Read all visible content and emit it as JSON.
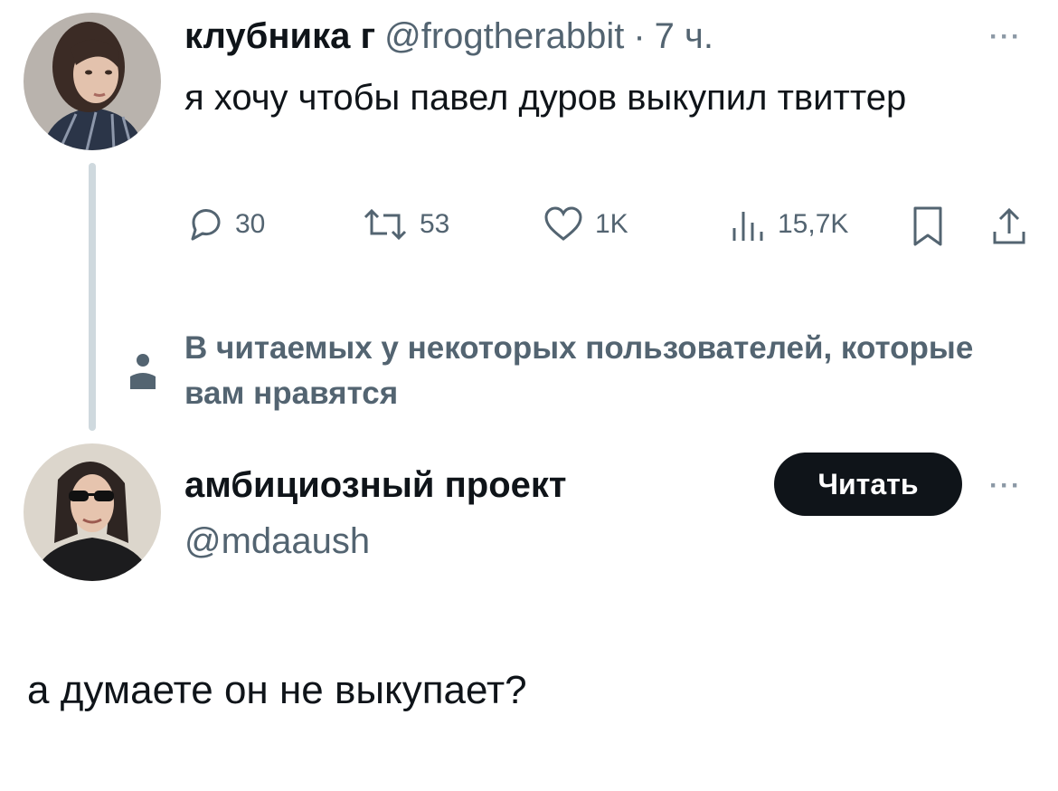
{
  "tweet": {
    "author_name": "клубника г",
    "author_handle": "@frogtherabbit",
    "separator": "·",
    "time": "7 ч.",
    "more": "···",
    "text": "я хочу чтобы павел дуров выкупил твиттер",
    "actions": {
      "replies": "30",
      "retweets": "53",
      "likes": "1K",
      "views": "15,7K"
    }
  },
  "social_context": {
    "text": "В читаемых у некоторых пользователей, которые вам нравятся"
  },
  "suggested_user": {
    "name": "амбициозный проект",
    "handle": "@mdaaush",
    "follow_label": "Читать",
    "more": "···"
  },
  "reply": {
    "text": "а думаете он не выкупает?"
  },
  "colors": {
    "text": "#0f1419",
    "secondary": "#536471",
    "thread_line": "#cfd9de",
    "button_bg": "#0f1419"
  },
  "icons": [
    "reply-icon",
    "retweet-icon",
    "like-icon",
    "views-icon",
    "bookmark-icon",
    "share-icon",
    "person-icon",
    "more-icon"
  ]
}
